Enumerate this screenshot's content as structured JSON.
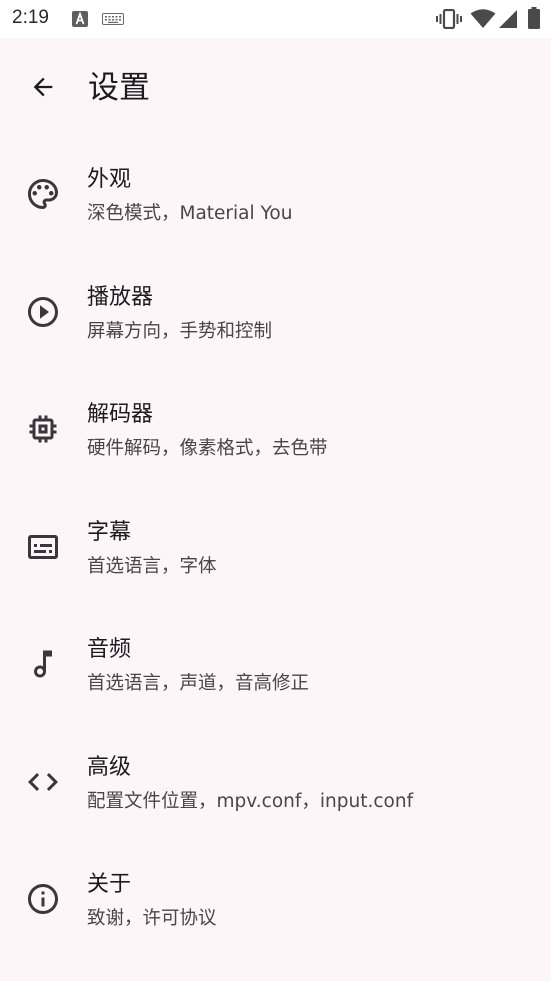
{
  "status_bar": {
    "time": "2:19",
    "icons": [
      "a-notification-icon",
      "keyboard-icon",
      "vibrate-icon",
      "wifi-icon",
      "cell-signal-icon",
      "battery-icon"
    ]
  },
  "app_bar": {
    "back_icon": "arrow-back-icon",
    "title": "设置"
  },
  "settings": [
    {
      "icon": "palette-icon",
      "title": "外观",
      "subtitle": "深色模式，Material You"
    },
    {
      "icon": "play-circle-icon",
      "title": "播放器",
      "subtitle": "屏幕方向，手势和控制"
    },
    {
      "icon": "memory-chip-icon",
      "title": "解码器",
      "subtitle": "硬件解码，像素格式，去色带"
    },
    {
      "icon": "subtitles-icon",
      "title": "字幕",
      "subtitle": "首选语言，字体"
    },
    {
      "icon": "music-note-icon",
      "title": "音频",
      "subtitle": "首选语言，声道，音高修正"
    },
    {
      "icon": "code-icon",
      "title": "高级",
      "subtitle": "配置文件位置，mpv.conf，input.conf"
    },
    {
      "icon": "info-icon",
      "title": "关于",
      "subtitle": "致谢，许可协议"
    }
  ],
  "colors": {
    "background": "#fdf6f8",
    "status_bar": "#ffffff",
    "text_primary": "#1d1b1e",
    "text_secondary": "#4a4549",
    "icon": "#3b3639"
  }
}
